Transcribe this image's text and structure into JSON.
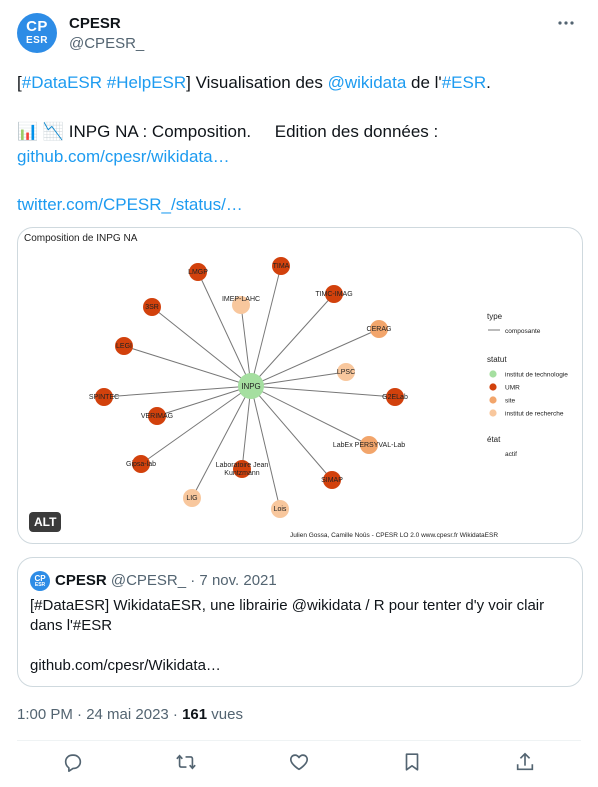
{
  "author": {
    "avatar_line1": "CP",
    "avatar_line2": "ESR",
    "name": "CPESR",
    "handle": "@CPESR_"
  },
  "more_icon": "more-horizontal-icon",
  "tweet": {
    "l1_open": "[",
    "l1_tag1": "#DataESR",
    "l1_space": " ",
    "l1_tag2": "#HelpESR",
    "l1_mid": "] Visualisation des ",
    "l1_mention": "@wikidata",
    "l1_mid2": " de l'",
    "l1_tag3": "#ESR",
    "l1_end": ".",
    "l2_emoji": "📊 📉",
    "l2_text": " INPG NA : Composition.     Edition des données : ",
    "l2_link": "github.com/cpesr/wikidata…",
    "l4_link": "twitter.com/CPESR_/status/…"
  },
  "media": {
    "alt_label": "ALT",
    "colors": {
      "institut_de_technologie": "#a5dfa0",
      "umr": "#d2410c",
      "site": "#f2a56b",
      "institut_de_recherche": "#f8c79d"
    }
  },
  "chart_data": {
    "type": "network",
    "title": "Composition de INPG NA",
    "center": {
      "label": "INPG",
      "statut": "institut de technologie"
    },
    "nodes": [
      {
        "label": "LMGP",
        "statut": "UMR"
      },
      {
        "label": "TIMA",
        "statut": "UMR"
      },
      {
        "label": "IMEP-LAHC",
        "statut": "institut de recherche"
      },
      {
        "label": "TIMC-IMAG",
        "statut": "UMR"
      },
      {
        "label": "3SR",
        "statut": "UMR"
      },
      {
        "label": "CERAG",
        "statut": "site"
      },
      {
        "label": "LEGI",
        "statut": "UMR"
      },
      {
        "label": "LPSC",
        "statut": "institut de recherche"
      },
      {
        "label": "SPINTEC",
        "statut": "UMR"
      },
      {
        "label": "G2ELab",
        "statut": "UMR"
      },
      {
        "label": "VERIMAG",
        "statut": "UMR"
      },
      {
        "label": "LabEx PERSYVAL-Lab",
        "statut": "site"
      },
      {
        "label": "Gipsa-lab",
        "statut": "UMR"
      },
      {
        "label": "Laboratoire Jean Kuntzmann",
        "statut": "UMR"
      },
      {
        "label": "SIMAP",
        "statut": "UMR"
      },
      {
        "label": "LIG",
        "statut": "institut de recherche"
      },
      {
        "label": "Lois",
        "statut": "institut de recherche"
      }
    ],
    "legend": {
      "type_title": "type",
      "type_item": "composante",
      "statut_title": "statut",
      "statut_items": [
        "institut de technologie",
        "UMR",
        "site",
        "institut de recherche"
      ],
      "etat_title": "état",
      "etat_item": "actif"
    },
    "caption": "Julien Gossa, Camille Noûs - CPESR LO 2.0 www.cpesr.fr WikidataESR"
  },
  "quote": {
    "avatar_line1": "CP",
    "avatar_line2": "ESR",
    "name": "CPESR",
    "meta": " @CPESR_ · 7 nov. 2021",
    "text_l1": "[#DataESR] WikidataESR, une librairie @wikidata / R pour tenter d'y voir clair",
    "text_l2": "dans l'#ESR",
    "text_l3": "github.com/cpesr/Wikidata…"
  },
  "meta": {
    "time": "1:00 PM · 24 mai 2023 · ",
    "views_count": "161",
    "views_label": " vues"
  },
  "actions": [
    "reply-icon",
    "retweet-icon",
    "like-icon",
    "bookmark-icon",
    "share-icon"
  ]
}
